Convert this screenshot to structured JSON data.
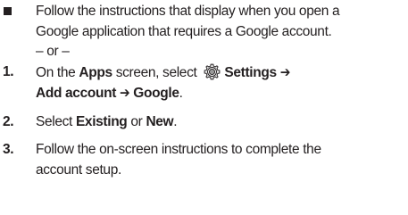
{
  "bullet": {
    "line1": "Follow the instructions that display when you open a",
    "line2": "Google application that requires a Google account.",
    "or": "– or –"
  },
  "steps": [
    {
      "number": "1.",
      "pre": "On the ",
      "apps": "Apps",
      "mid": " screen, select ",
      "icon": "settings-gear-icon",
      "settings": "Settings",
      "arrow": "➔",
      "add_account": "Add account",
      "arrow2": "➔",
      "google": "Google",
      "end": "."
    },
    {
      "number": "2.",
      "pre": "Select ",
      "existing": "Existing",
      "or": " or ",
      "new": "New",
      "end": "."
    },
    {
      "number": "3.",
      "line1": "Follow the on-screen instructions to complete the",
      "line2": "account setup."
    }
  ]
}
